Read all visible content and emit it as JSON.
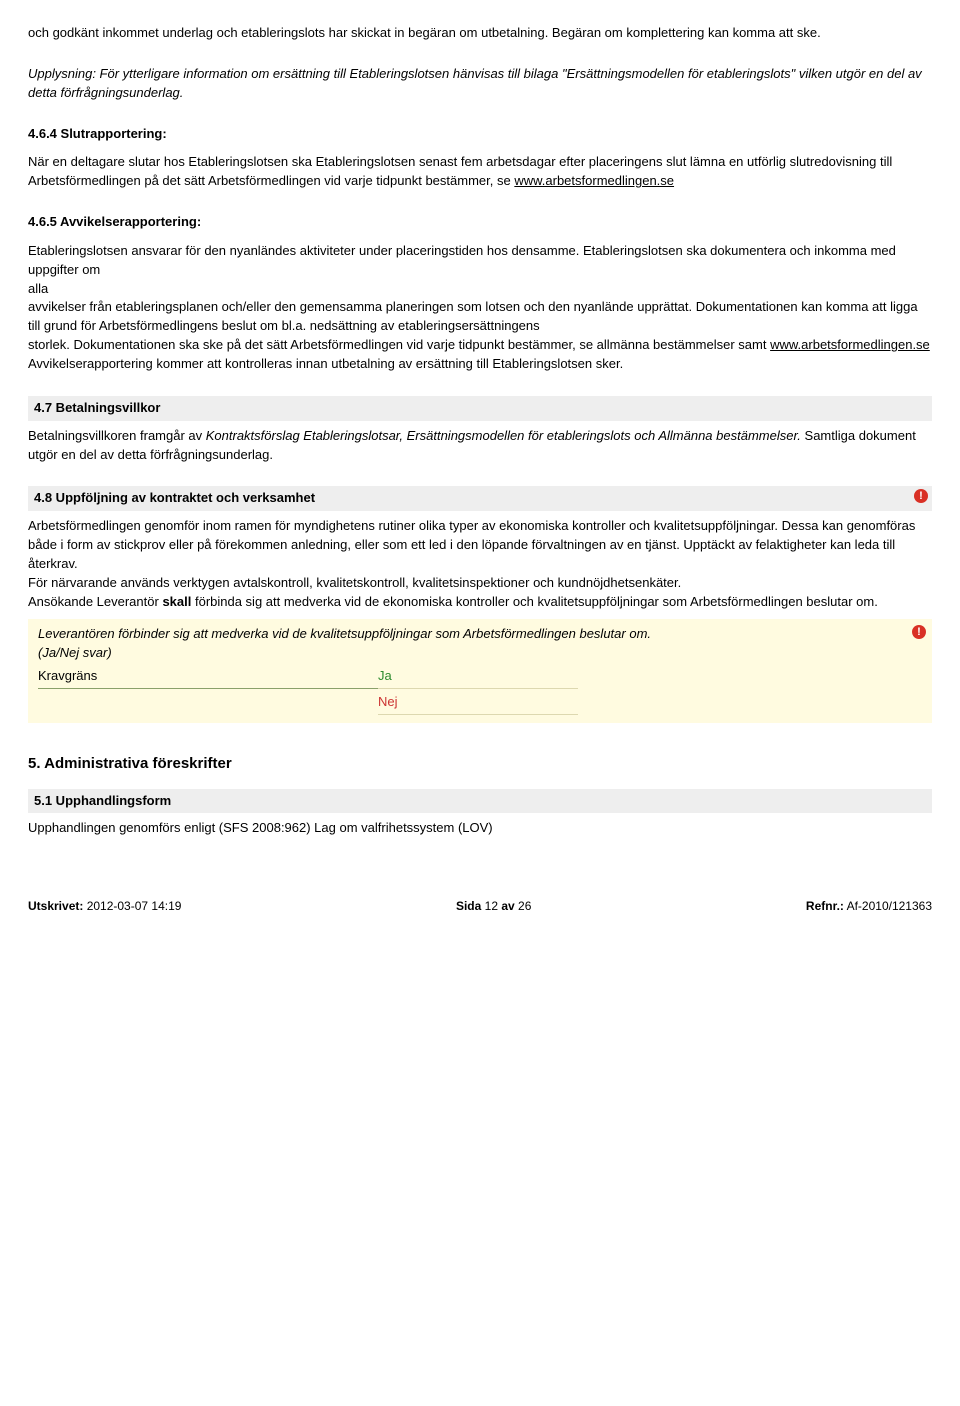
{
  "intro": {
    "p1": "och godkänt inkommet underlag och etableringslots har skickat in begäran om utbetalning. Begäran om komplettering kan komma att ske.",
    "p2a": "Upplysning: För ytterligare information om ersättning till Etableringslotsen hänvisas till bilaga \"Ersättningsmodellen för etableringslots\" vilken utgör en del av detta förfrågningsunderlag."
  },
  "s464": {
    "heading": "4.6.4 Slutrapportering:",
    "p1": "När en deltagare slutar hos Etableringslotsen ska Etableringslotsen senast fem arbetsdagar efter placeringens slut lämna en utförlig slutredovisning till Arbetsförmedlingen på det sätt Arbetsförmedlingen vid varje tidpunkt bestämmer, se ",
    "link": "www.arbetsformedlingen.se"
  },
  "s465": {
    "heading": "4.6.5 Avvikelserapportering:",
    "p1": "Etableringslotsen ansvarar för den nyanländes aktiviteter under placeringstiden hos densamme. Etableringslotsen ska dokumentera och inkomma med uppgifter om",
    "p1b": "alla",
    "p1c": "avvikelser från etableringsplanen och/eller den gemensamma planeringen som lotsen och den nyanlände upprättat. Dokumentationen kan komma att ligga till grund för Arbetsförmedlingens beslut om bl.a. nedsättning av etableringsersättningens",
    "p1d": "storlek. Dokumentationen ska ske på det sätt Arbetsförmedlingen vid varje tidpunkt bestämmer, se allmänna bestämmelser samt ",
    "link": "www.arbetsformedlingen.se",
    "p2": "Avvikelserapportering kommer att kontrolleras innan utbetalning av ersättning till Etableringslotsen sker."
  },
  "s47": {
    "bar": "4.7 Betalningsvillkor",
    "p1a": "Betalningsvillkoren framgår av ",
    "p1i": "Kontraktsförslag Etableringslotsar, Ersättningsmodellen för etableringslots och Allmänna bestämmelser.",
    "p1b": " Samtliga dokument utgör en del av detta förfrågningsunderlag."
  },
  "s48": {
    "bar": "4.8 Uppföljning av kontraktet och verksamhet",
    "p1": "Arbetsförmedlingen genomför inom ramen för myndighetens rutiner olika typer av ekonomiska kontroller och kvalitetsuppföljningar. Dessa kan genomföras både i form av stickprov eller på förekommen anledning, eller som ett led i den löpande förvaltningen av en tjänst. Upptäckt av felaktigheter kan leda till återkrav.",
    "p2": "För närvarande används verktygen avtalskontroll, kvalitetskontroll, kvalitetsinspektioner och kundnöjdhetsenkäter.",
    "p3a": "Ansökande Leverantör ",
    "p3b": "skall",
    "p3c": " förbinda sig att medverka vid de ekonomiska kontroller och kvalitetsuppföljningar som Arbetsförmedlingen beslutar om.",
    "q": "Leverantören förbinder sig att medverka vid de kvalitetsuppföljningar som Arbetsförmedlingen beslutar om.",
    "qtype": "(Ja/Nej svar)",
    "krav": "Kravgräns",
    "ja": "Ja",
    "nej": "Nej"
  },
  "s5": {
    "h": "5. Administrativa föreskrifter"
  },
  "s51": {
    "bar": "5.1     Upphandlingsform",
    "p1": "Upphandlingen genomförs enligt (SFS 2008:962) Lag om valfrihetssystem (LOV)"
  },
  "footer": {
    "leftLabel": "Utskrivet:",
    "leftVal": " 2012-03-07 14:19",
    "midLabel": "Sida ",
    "midPage": "12",
    "midOf": " av ",
    "midTotal": "26",
    "rightLabel": "Refnr.:",
    "rightVal": " Af-2010/121363"
  }
}
